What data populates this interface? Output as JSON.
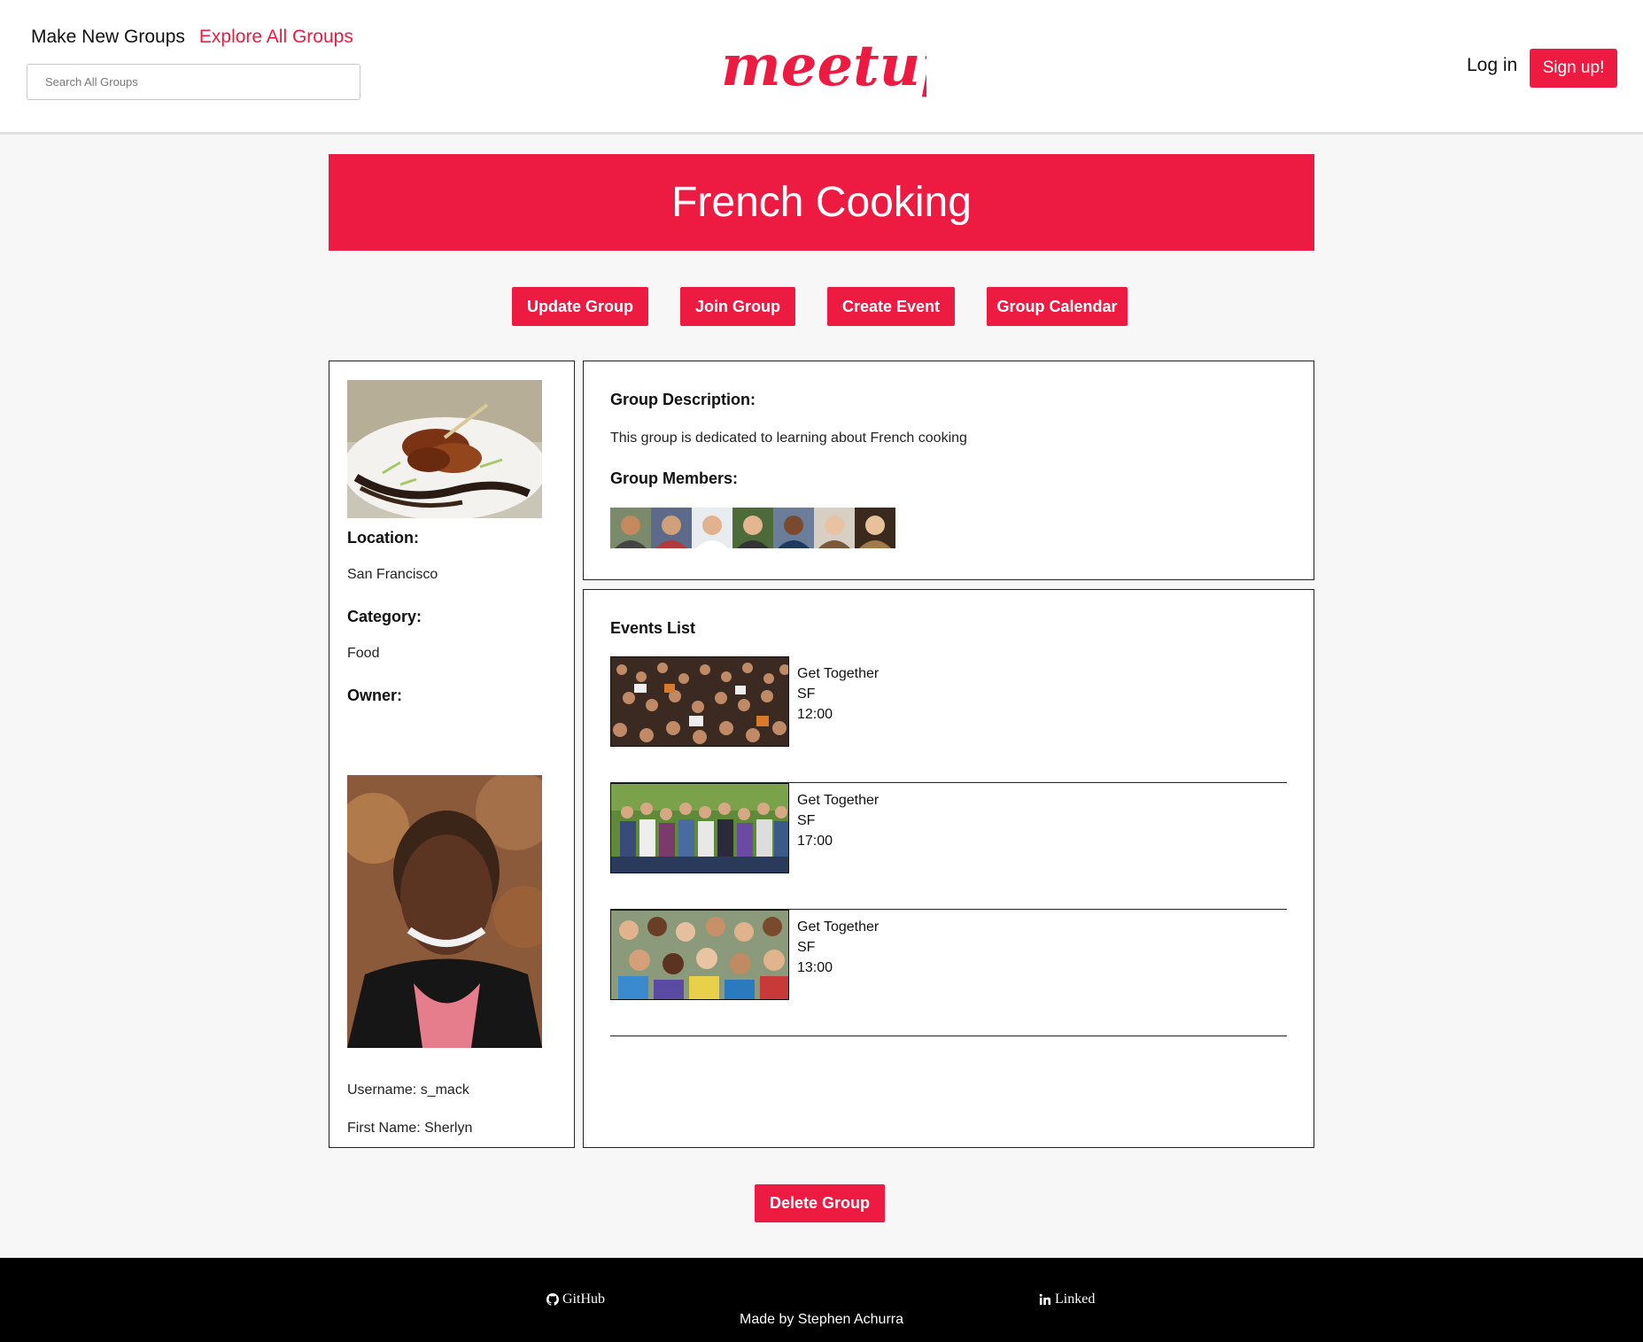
{
  "header": {
    "make_groups": "Make New Groups",
    "explore_groups": "Explore All Groups",
    "search_placeholder": "Search All Groups",
    "logo_text": "meetup",
    "login": "Log in",
    "signup": "Sign up!"
  },
  "group": {
    "title": "French Cooking",
    "actions": {
      "update": "Update Group",
      "join": "Join Group",
      "create_event": "Create Event",
      "calendar": "Group Calendar"
    },
    "location_label": "Location:",
    "location": "San Francisco",
    "category_label": "Category:",
    "category": "Food",
    "owner_label": "Owner:",
    "owner_username": "Username: s_mack",
    "owner_first_name": "First Name: Sherlyn",
    "description_label": "Group Description:",
    "description": "This group is dedicated to learning about French cooking",
    "members_label": "Group Members:",
    "delete": "Delete Group"
  },
  "events": {
    "title": "Events List",
    "items": [
      {
        "name": "Get Together",
        "location": "SF",
        "time": "12:00"
      },
      {
        "name": "Get Together",
        "location": "SF",
        "time": "17:00"
      },
      {
        "name": "Get Together",
        "location": "SF",
        "time": "13:00"
      }
    ]
  },
  "footer": {
    "github": "GitHub",
    "linkedin": "Linked",
    "credit": "Made by Stephen Achurra"
  },
  "colors": {
    "accent": "#ed1b41",
    "footer_bg": "#000000",
    "page_bg": "#f7f7f7"
  }
}
